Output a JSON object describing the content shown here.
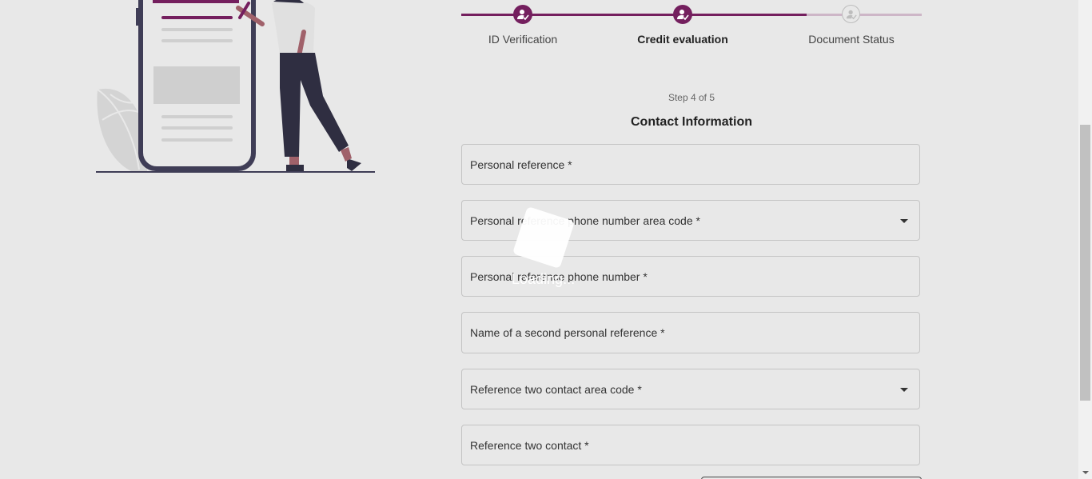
{
  "stepper": {
    "steps": [
      {
        "label": "ID Verification",
        "state": "complete"
      },
      {
        "label": "Credit evaluation",
        "state": "current"
      },
      {
        "label": "Document Status",
        "state": "pending"
      }
    ]
  },
  "form": {
    "step_count": "Step 4 of 5",
    "title": "Contact Information",
    "fields": [
      {
        "label": "Personal reference *",
        "type": "text"
      },
      {
        "label": "Personal reference phone number area code *",
        "type": "select"
      },
      {
        "label": "Personal reference phone number *",
        "type": "text"
      },
      {
        "label": "Name of a second personal reference *",
        "type": "text"
      },
      {
        "label": "Reference two contact area code *",
        "type": "select"
      },
      {
        "label": "Reference two contact *",
        "type": "text"
      }
    ]
  },
  "loading": {
    "text": "Loading..."
  },
  "colors": {
    "accent": "#741f5e",
    "accent_light": "#cdb6c7",
    "background": "#e8e8e8"
  }
}
